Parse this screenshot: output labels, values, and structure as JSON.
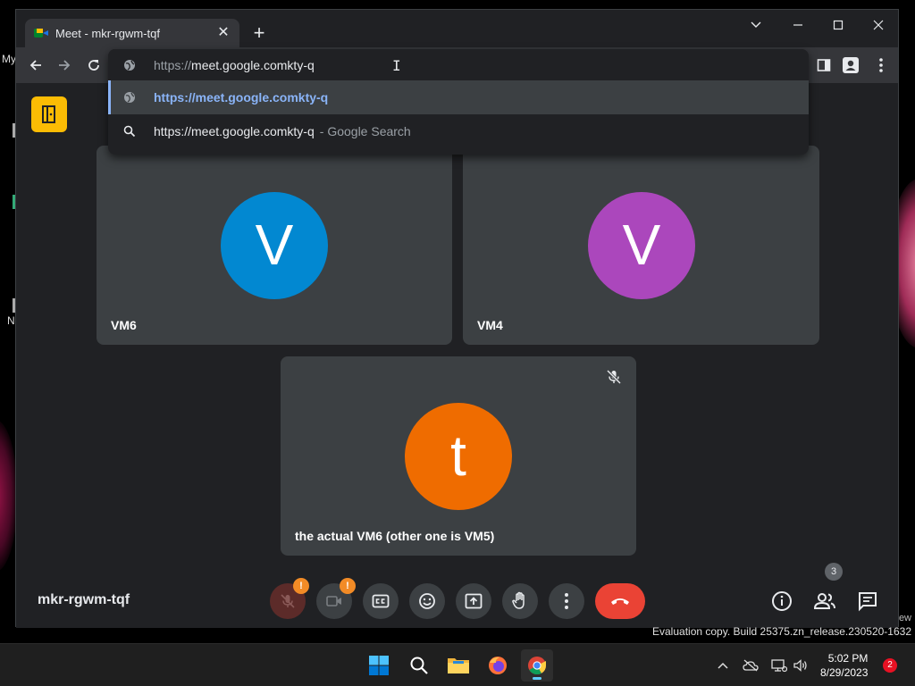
{
  "desktop": {
    "labels": [
      "My",
      "N"
    ]
  },
  "browser": {
    "tab": {
      "title": "Meet - mkr-rgwm-tqf"
    },
    "omnibox": {
      "typed_scheme": "https://",
      "typed_host": "meet.google.comkty-q",
      "suggestions": [
        {
          "text": "https://meet.google.comkty-q",
          "type": "url",
          "selected": true
        },
        {
          "text": "https://meet.google.comkty-q",
          "suffix": "- Google Search",
          "type": "search",
          "selected": false
        }
      ]
    }
  },
  "meet": {
    "meeting_code": "mkr-rgwm-tqf",
    "participants": [
      {
        "name": "VM6",
        "initial": "V",
        "color": "#0288d1",
        "muted": false
      },
      {
        "name": "VM4",
        "initial": "V",
        "color": "#ab47bc",
        "muted": false
      },
      {
        "name": "the actual VM6 (other one is VM5)",
        "initial": "t",
        "color": "#ef6c00",
        "muted": true
      }
    ],
    "controls": {
      "mic_warning": "!",
      "camera_warning": "!",
      "people_count": "3"
    }
  },
  "watermark": {
    "partial": "ew",
    "text": "Evaluation copy. Build 25375.zn_release.230520-1632"
  },
  "taskbar": {
    "time": "5:02 PM",
    "date": "8/29/2023",
    "notifications": "2"
  }
}
